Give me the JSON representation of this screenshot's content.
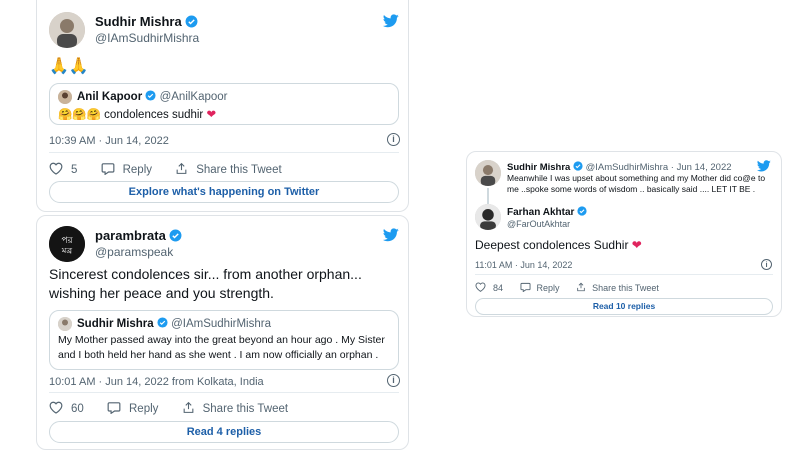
{
  "colors": {
    "accent": "#1d9bf0",
    "heart": "#e0245e",
    "link": "#1d5fa8",
    "muted": "#536471"
  },
  "tweet1": {
    "author_name": "Sudhir Mishra",
    "author_handle": "@IAmSudhirMishra",
    "body": "🙏🙏",
    "quote": {
      "author_name": "Anil Kapoor",
      "author_handle": "@AnilKapoor",
      "emojis": "🤗🤗🤗",
      "text": "condolences sudhir",
      "heart": "❤"
    },
    "timestamp": "10:39 AM · Jun 14, 2022",
    "likes": "5",
    "reply_label": "Reply",
    "share_label": "Share this Tweet",
    "cta_label": "Explore what's happening on Twitter"
  },
  "tweet2": {
    "author_name": "parambrata",
    "author_handle": "@paramspeak",
    "body": "Sincerest condolences sir... from another orphan... wishing her peace and you strength.",
    "quote": {
      "author_name": "Sudhir Mishra",
      "author_handle": "@IAmSudhirMishra",
      "text": "My Mother passed away into the great beyond an hour ago . My Sister and I both held her hand as she went . I am now officially an orphan ."
    },
    "timestamp": "10:01 AM · Jun 14, 2022 from Kolkata, India",
    "likes": "60",
    "reply_label": "Reply",
    "share_label": "Share this Tweet",
    "cta_label": "Read 4 replies"
  },
  "tweet3": {
    "parent": {
      "author_name": "Sudhir Mishra",
      "author_handle": "@IAmSudhirMishra",
      "date": "· Jun 14, 2022",
      "text": "Meanwhile I was upset about something and my Mother did co@e to me ..spoke some words of wisdom .. basically said .... LET IT  BE ."
    },
    "author_name": "Farhan Akhtar",
    "author_handle": "@FarOutAkhtar",
    "body": "Deepest condolences Sudhir",
    "heart": "❤",
    "timestamp": "11:01 AM · Jun 14, 2022",
    "likes": "84",
    "reply_label": "Reply",
    "share_label": "Share this Tweet",
    "cta_label": "Read 10 replies"
  },
  "icons": [
    "twitter-bird-icon",
    "verified-badge-icon",
    "heart-icon",
    "reply-icon",
    "share-icon",
    "info-icon"
  ]
}
